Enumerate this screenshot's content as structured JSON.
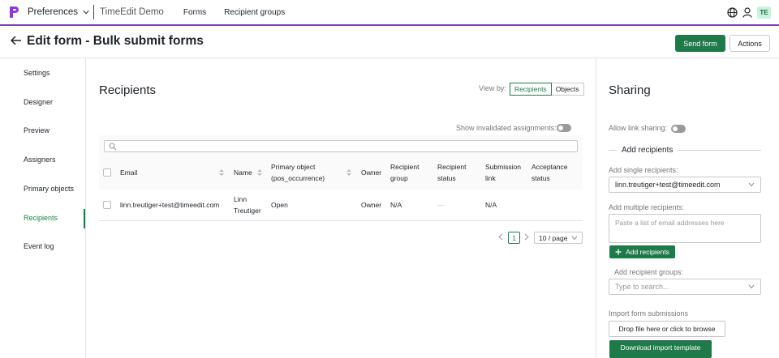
{
  "topbar": {
    "app_name": "Preferences",
    "org_name": "TimeEdit Demo",
    "nav": [
      "Forms",
      "Recipient groups"
    ],
    "avatar_initials": "TE",
    "brand_color": "#8a3bd1"
  },
  "header": {
    "title": "Edit form - Bulk submit forms",
    "send_label": "Send form",
    "actions_label": "Actions"
  },
  "sidebar": {
    "items": [
      {
        "label": "Settings"
      },
      {
        "label": "Designer"
      },
      {
        "label": "Preview"
      },
      {
        "label": "Assigners"
      },
      {
        "label": "Primary objects"
      },
      {
        "label": "Recipients"
      },
      {
        "label": "Event log"
      }
    ],
    "active": "Recipients",
    "accent_color": "#1f7a4a"
  },
  "recipients": {
    "title": "Recipients",
    "view_by_label": "View by:",
    "view_by_options": [
      "Recipients",
      "Objects"
    ],
    "view_by_selected": "Recipients",
    "show_invalidated_label": "Show invalidated assignments:",
    "show_invalidated": false,
    "search_value": "",
    "columns": [
      {
        "label": "Email"
      },
      {
        "label": "Name"
      },
      {
        "label": "Primary object (pos_occurrence)"
      },
      {
        "label": "Owner"
      },
      {
        "label": "Recipient group"
      },
      {
        "label": "Recipient status"
      },
      {
        "label": "Submission link"
      },
      {
        "label": "Acceptance status"
      }
    ],
    "rows": [
      {
        "email": "linn.treutiger+test@timeedit.com",
        "name": "Linn Treutiger",
        "primary_object": "Open",
        "owner": "Owner",
        "recipient_group": "N/A",
        "recipient_status": "—",
        "submission_link": "N/A",
        "acceptance_status": ""
      }
    ],
    "pagination": {
      "current_page": "1",
      "page_size": "10 / page"
    }
  },
  "sharing": {
    "title": "Sharing",
    "allow_link_label": "Allow link sharing:",
    "allow_link": false,
    "add_recipients_heading": "Add recipients",
    "single_label": "Add single recipients:",
    "single_value": "linn.treutiger+test@timeedit.com",
    "multiple_label": "Add multiple recipients:",
    "multiple_placeholder": "Paste a list of email addresses here",
    "add_button": "Add recipients",
    "groups_label": "Add recipient groups:",
    "groups_placeholder": "Type to search...",
    "import_label": "Import form submissions",
    "drop_label": "Drop file here or click to browse",
    "download_label": "Download import template"
  }
}
